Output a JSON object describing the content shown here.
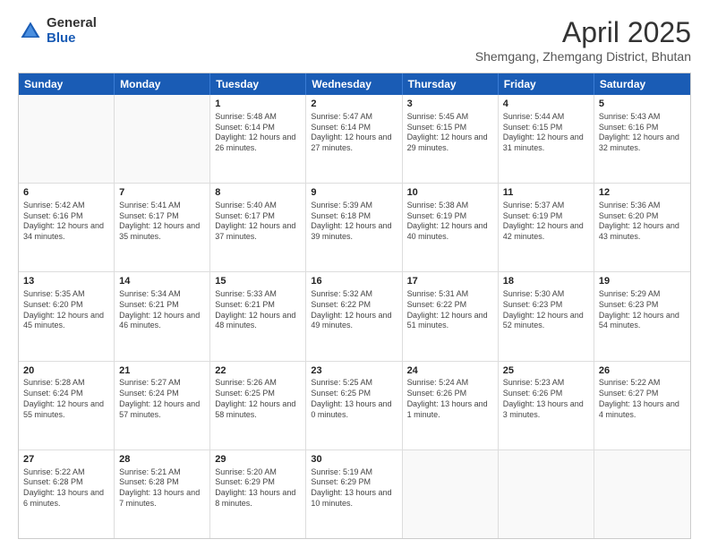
{
  "logo": {
    "general": "General",
    "blue": "Blue"
  },
  "title": {
    "month": "April 2025",
    "location": "Shemgang, Zhemgang District, Bhutan"
  },
  "header_days": [
    "Sunday",
    "Monday",
    "Tuesday",
    "Wednesday",
    "Thursday",
    "Friday",
    "Saturday"
  ],
  "rows": [
    [
      {
        "day": "",
        "info": ""
      },
      {
        "day": "",
        "info": ""
      },
      {
        "day": "1",
        "info": "Sunrise: 5:48 AM\nSunset: 6:14 PM\nDaylight: 12 hours and 26 minutes."
      },
      {
        "day": "2",
        "info": "Sunrise: 5:47 AM\nSunset: 6:14 PM\nDaylight: 12 hours and 27 minutes."
      },
      {
        "day": "3",
        "info": "Sunrise: 5:45 AM\nSunset: 6:15 PM\nDaylight: 12 hours and 29 minutes."
      },
      {
        "day": "4",
        "info": "Sunrise: 5:44 AM\nSunset: 6:15 PM\nDaylight: 12 hours and 31 minutes."
      },
      {
        "day": "5",
        "info": "Sunrise: 5:43 AM\nSunset: 6:16 PM\nDaylight: 12 hours and 32 minutes."
      }
    ],
    [
      {
        "day": "6",
        "info": "Sunrise: 5:42 AM\nSunset: 6:16 PM\nDaylight: 12 hours and 34 minutes."
      },
      {
        "day": "7",
        "info": "Sunrise: 5:41 AM\nSunset: 6:17 PM\nDaylight: 12 hours and 35 minutes."
      },
      {
        "day": "8",
        "info": "Sunrise: 5:40 AM\nSunset: 6:17 PM\nDaylight: 12 hours and 37 minutes."
      },
      {
        "day": "9",
        "info": "Sunrise: 5:39 AM\nSunset: 6:18 PM\nDaylight: 12 hours and 39 minutes."
      },
      {
        "day": "10",
        "info": "Sunrise: 5:38 AM\nSunset: 6:19 PM\nDaylight: 12 hours and 40 minutes."
      },
      {
        "day": "11",
        "info": "Sunrise: 5:37 AM\nSunset: 6:19 PM\nDaylight: 12 hours and 42 minutes."
      },
      {
        "day": "12",
        "info": "Sunrise: 5:36 AM\nSunset: 6:20 PM\nDaylight: 12 hours and 43 minutes."
      }
    ],
    [
      {
        "day": "13",
        "info": "Sunrise: 5:35 AM\nSunset: 6:20 PM\nDaylight: 12 hours and 45 minutes."
      },
      {
        "day": "14",
        "info": "Sunrise: 5:34 AM\nSunset: 6:21 PM\nDaylight: 12 hours and 46 minutes."
      },
      {
        "day": "15",
        "info": "Sunrise: 5:33 AM\nSunset: 6:21 PM\nDaylight: 12 hours and 48 minutes."
      },
      {
        "day": "16",
        "info": "Sunrise: 5:32 AM\nSunset: 6:22 PM\nDaylight: 12 hours and 49 minutes."
      },
      {
        "day": "17",
        "info": "Sunrise: 5:31 AM\nSunset: 6:22 PM\nDaylight: 12 hours and 51 minutes."
      },
      {
        "day": "18",
        "info": "Sunrise: 5:30 AM\nSunset: 6:23 PM\nDaylight: 12 hours and 52 minutes."
      },
      {
        "day": "19",
        "info": "Sunrise: 5:29 AM\nSunset: 6:23 PM\nDaylight: 12 hours and 54 minutes."
      }
    ],
    [
      {
        "day": "20",
        "info": "Sunrise: 5:28 AM\nSunset: 6:24 PM\nDaylight: 12 hours and 55 minutes."
      },
      {
        "day": "21",
        "info": "Sunrise: 5:27 AM\nSunset: 6:24 PM\nDaylight: 12 hours and 57 minutes."
      },
      {
        "day": "22",
        "info": "Sunrise: 5:26 AM\nSunset: 6:25 PM\nDaylight: 12 hours and 58 minutes."
      },
      {
        "day": "23",
        "info": "Sunrise: 5:25 AM\nSunset: 6:25 PM\nDaylight: 13 hours and 0 minutes."
      },
      {
        "day": "24",
        "info": "Sunrise: 5:24 AM\nSunset: 6:26 PM\nDaylight: 13 hours and 1 minute."
      },
      {
        "day": "25",
        "info": "Sunrise: 5:23 AM\nSunset: 6:26 PM\nDaylight: 13 hours and 3 minutes."
      },
      {
        "day": "26",
        "info": "Sunrise: 5:22 AM\nSunset: 6:27 PM\nDaylight: 13 hours and 4 minutes."
      }
    ],
    [
      {
        "day": "27",
        "info": "Sunrise: 5:22 AM\nSunset: 6:28 PM\nDaylight: 13 hours and 6 minutes."
      },
      {
        "day": "28",
        "info": "Sunrise: 5:21 AM\nSunset: 6:28 PM\nDaylight: 13 hours and 7 minutes."
      },
      {
        "day": "29",
        "info": "Sunrise: 5:20 AM\nSunset: 6:29 PM\nDaylight: 13 hours and 8 minutes."
      },
      {
        "day": "30",
        "info": "Sunrise: 5:19 AM\nSunset: 6:29 PM\nDaylight: 13 hours and 10 minutes."
      },
      {
        "day": "",
        "info": ""
      },
      {
        "day": "",
        "info": ""
      },
      {
        "day": "",
        "info": ""
      }
    ]
  ]
}
